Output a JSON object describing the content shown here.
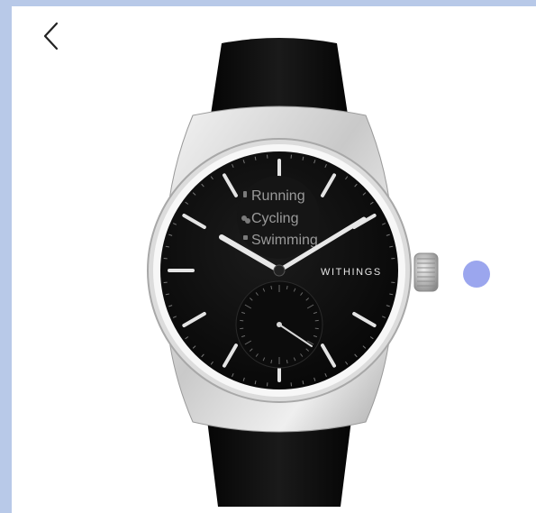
{
  "nav": {
    "back_icon": "chevron-left-icon"
  },
  "product": {
    "brand": "WITHINGS",
    "activities": [
      "Running",
      "Cycling",
      "Swimming"
    ]
  },
  "colors": {
    "page_bg": "#b8c9e8",
    "panel": "#ffffff",
    "indicator": "#9ba6ee",
    "dial": "#0a0a0a",
    "strap": "#0c0c0c"
  },
  "carousel": {
    "indicator_icon": "dot-indicator"
  }
}
